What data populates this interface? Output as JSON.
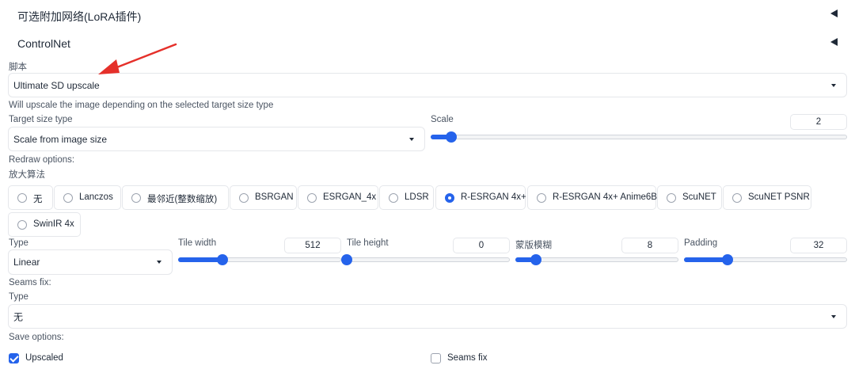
{
  "accordions": {
    "lora": "可选附加网络(LoRA插件)",
    "controlnet": "ControlNet"
  },
  "script": {
    "label": "脚本",
    "value": "Ultimate SD upscale",
    "note": "Will upscale the image depending on the selected target size type"
  },
  "target_size": {
    "label": "Target size type",
    "value": "Scale from image size"
  },
  "scale": {
    "label": "Scale",
    "value": "2",
    "fraction": 0.05
  },
  "redraw": {
    "label": "Redraw options:",
    "upscaler_label": "放大算法",
    "upscalers": [
      "无",
      "Lanczos",
      "最邻近(整数缩放)",
      "BSRGAN",
      "ESRGAN_4x",
      "LDSR",
      "R-ESRGAN 4x+",
      "R-ESRGAN 4x+ Anime6B",
      "ScuNET",
      "ScuNET PSNR",
      "SwinIR 4x"
    ],
    "selected": "R-ESRGAN 4x+",
    "type_label": "Type",
    "type_value": "Linear",
    "tile_width": {
      "label": "Tile width",
      "value": "512",
      "fraction": 0.27
    },
    "tile_height": {
      "label": "Tile height",
      "value": "0",
      "fraction": 0.0
    },
    "mask_blur": {
      "label": "蒙版模糊",
      "value": "8",
      "fraction": 0.125
    },
    "padding": {
      "label": "Padding",
      "value": "32",
      "fraction": 0.265
    }
  },
  "seams": {
    "label": "Seams fix:",
    "type_label": "Type",
    "type_value": "无"
  },
  "save": {
    "label": "Save options:",
    "upscaled": {
      "label": "Upscaled",
      "checked": true
    },
    "seams_fix": {
      "label": "Seams fix",
      "checked": false
    }
  },
  "colors": {
    "accent": "#2563eb",
    "annotation": "#e5302a"
  },
  "icons": {
    "accordion": "triangle-left-icon",
    "dropdown": "chevron-down-icon"
  }
}
